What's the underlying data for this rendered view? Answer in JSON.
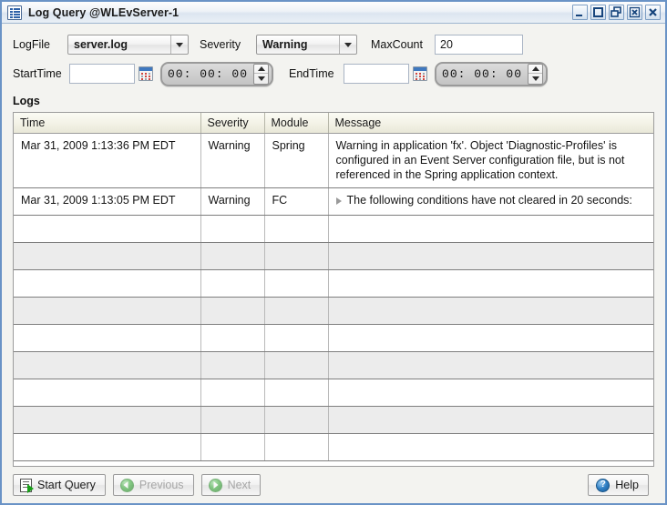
{
  "window": {
    "title": "Log Query @WLEvServer-1",
    "icon": "list-document-icon",
    "controls": [
      {
        "name": "minimize-button",
        "glyph": "minimize"
      },
      {
        "name": "maximize-button",
        "glyph": "maximize"
      },
      {
        "name": "restore-button",
        "glyph": "restore"
      },
      {
        "name": "close-window-button",
        "glyph": "close-box"
      },
      {
        "name": "close-button",
        "glyph": "close"
      }
    ]
  },
  "form": {
    "logfile": {
      "label": "LogFile",
      "value": "server.log",
      "options": [
        "server.log"
      ]
    },
    "severity": {
      "label": "Severity",
      "value": "Warning",
      "options": [
        "Warning"
      ]
    },
    "maxcount": {
      "label": "MaxCount",
      "value": "20",
      "placeholder": ""
    },
    "starttime": {
      "label": "StartTime",
      "value": "",
      "placeholder": "",
      "calendar_icon": "calendar-icon",
      "time": "00: 00: 00"
    },
    "endtime": {
      "label": "EndTime",
      "value": "",
      "placeholder": "",
      "calendar_icon": "calendar-icon",
      "time": "00: 00: 00"
    }
  },
  "logs": {
    "section_label": "Logs",
    "columns": [
      "Time",
      "Severity",
      "Module",
      "Message"
    ],
    "rows": [
      {
        "time": "Mar 31, 2009 1:13:36 PM EDT",
        "severity": "Warning",
        "module": "Spring",
        "message": "Warning in application 'fx'.  Object 'Diagnostic-Profiles' is configured in an Event Server configuration file, but is not referenced in the Spring application context.",
        "expandable": false
      },
      {
        "time": "Mar 31, 2009 1:13:05 PM EDT",
        "severity": "Warning",
        "module": "FC",
        "message": "The following conditions have not cleared in 20 seconds:",
        "expandable": true
      }
    ],
    "empty_row_count": 9
  },
  "toolbar": {
    "start_query": {
      "label": "Start Query",
      "icon": "run-document-icon",
      "enabled": true
    },
    "previous": {
      "label": "Previous",
      "icon": "arrow-left-circle-icon",
      "enabled": false
    },
    "next": {
      "label": "Next",
      "icon": "arrow-right-circle-icon",
      "enabled": false
    },
    "help": {
      "label": "Help",
      "icon": "help-circle-icon",
      "glyph": "?",
      "enabled": true
    }
  },
  "colors": {
    "window_border": "#6a93c6",
    "panel_bg": "#f3f3f0",
    "header_bg": "#f3f2e6",
    "row_alt_bg": "#ececec",
    "accent_green": "#28a828",
    "accent_blue": "#2f7fc4"
  }
}
